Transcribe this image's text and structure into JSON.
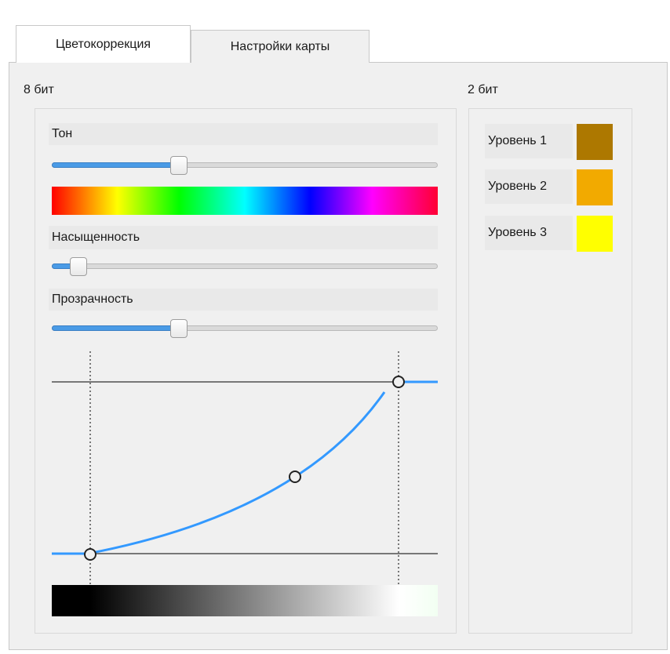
{
  "tabs": [
    {
      "label": "Цветокоррекция",
      "active": true
    },
    {
      "label": "Настройки карты",
      "active": false
    }
  ],
  "group_8bit": {
    "title": "8 бит",
    "hue": {
      "label": "Тон",
      "value_fraction": 0.33
    },
    "saturation": {
      "label": "Насыщенность",
      "value_fraction": 0.07
    },
    "transparency": {
      "label": "Прозрачность",
      "value_fraction": 0.33
    },
    "curve": {
      "low_point": [
        0.1,
        0.0
      ],
      "mid_point": [
        0.63,
        0.44
      ],
      "high_point": [
        0.9,
        1.0
      ]
    }
  },
  "group_2bit": {
    "title": "2 бит",
    "levels": [
      {
        "label": "Уровень 1",
        "color": "#ad7800"
      },
      {
        "label": "Уровень 2",
        "color": "#f2aa00"
      },
      {
        "label": "Уровень 3",
        "color": "#ffff00"
      }
    ]
  }
}
